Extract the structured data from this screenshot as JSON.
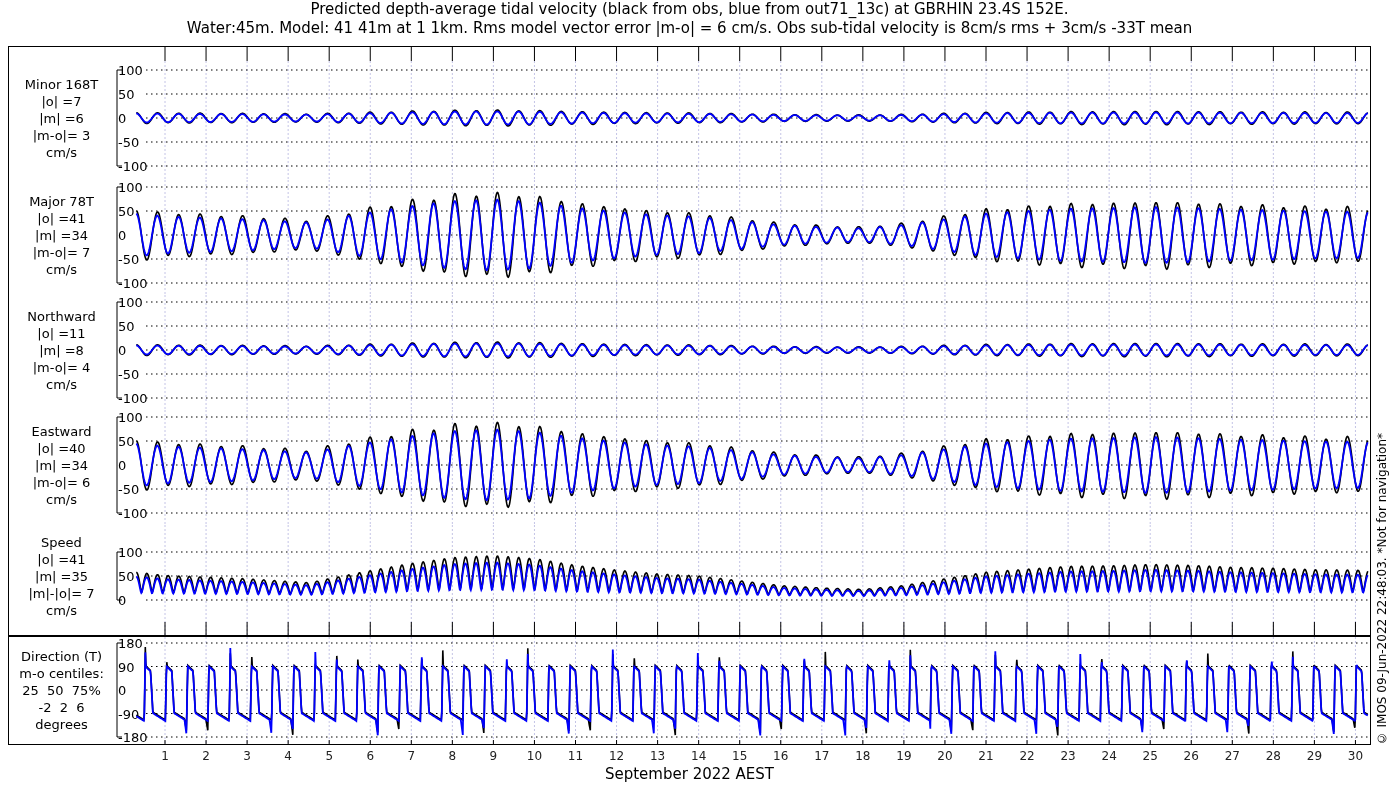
{
  "title": {
    "lines": [
      "Predicted depth-average tidal velocity (black from obs, blue from out71_13c) at GBRHIN 23.4S 152E.",
      "Water:45m. Model: 41 41m at 1 1km. Rms model vector error |m-o| = 6 cm/s. Obs sub-tidal velocity is 8cm/s rms + 3cm/s -33T mean"
    ]
  },
  "panels": [
    {
      "kind": "component-small",
      "label": [
        "Minor 168T",
        "|o| =7",
        "|m| =6",
        "|m-o|= 3",
        "cm/s"
      ],
      "y_ticks": [
        "100",
        "50",
        "0",
        "-50",
        "-100"
      ]
    },
    {
      "kind": "component-large",
      "label": [
        "Major 78T",
        "|o| =41",
        "|m| =34",
        "|m-o|= 7",
        "cm/s"
      ],
      "y_ticks": [
        "100",
        "50",
        "0",
        "-50",
        "-100"
      ]
    },
    {
      "kind": "component-small",
      "label": [
        "Northward",
        "|o| =11",
        "|m| =8",
        "|m-o|= 4",
        "cm/s"
      ],
      "y_ticks": [
        "100",
        "50",
        "0",
        "-50",
        "-100"
      ]
    },
    {
      "kind": "component-large",
      "label": [
        "Eastward",
        "|o| =40",
        "|m| =34",
        "|m-o|= 6",
        "cm/s"
      ],
      "y_ticks": [
        "100",
        "50",
        "0",
        "-50",
        "-100"
      ]
    },
    {
      "kind": "speed",
      "label": [
        "Speed",
        "|o| =41",
        "|m| =35",
        "|m|-|o|= 7",
        "cm/s"
      ],
      "y_ticks": [
        "100",
        "50",
        "0"
      ]
    },
    {
      "kind": "direction",
      "label": [
        "Direction (T)",
        "m-o centiles:",
        "25  50  75%",
        "-2  2  6",
        "degrees"
      ],
      "y_ticks": [
        "180",
        "90",
        "0",
        "-90",
        "-180"
      ]
    }
  ],
  "x_axis": {
    "ticks": [
      "1",
      "2",
      "3",
      "4",
      "5",
      "6",
      "7",
      "8",
      "9",
      "10",
      "11",
      "12",
      "13",
      "14",
      "15",
      "16",
      "17",
      "18",
      "19",
      "20",
      "21",
      "22",
      "23",
      "24",
      "25",
      "26",
      "27",
      "28",
      "29",
      "30"
    ],
    "label": "September 2022 AEST"
  },
  "credit": "© IMOS 09-Jun-2022 22:48:03. *Not for navigation*"
}
